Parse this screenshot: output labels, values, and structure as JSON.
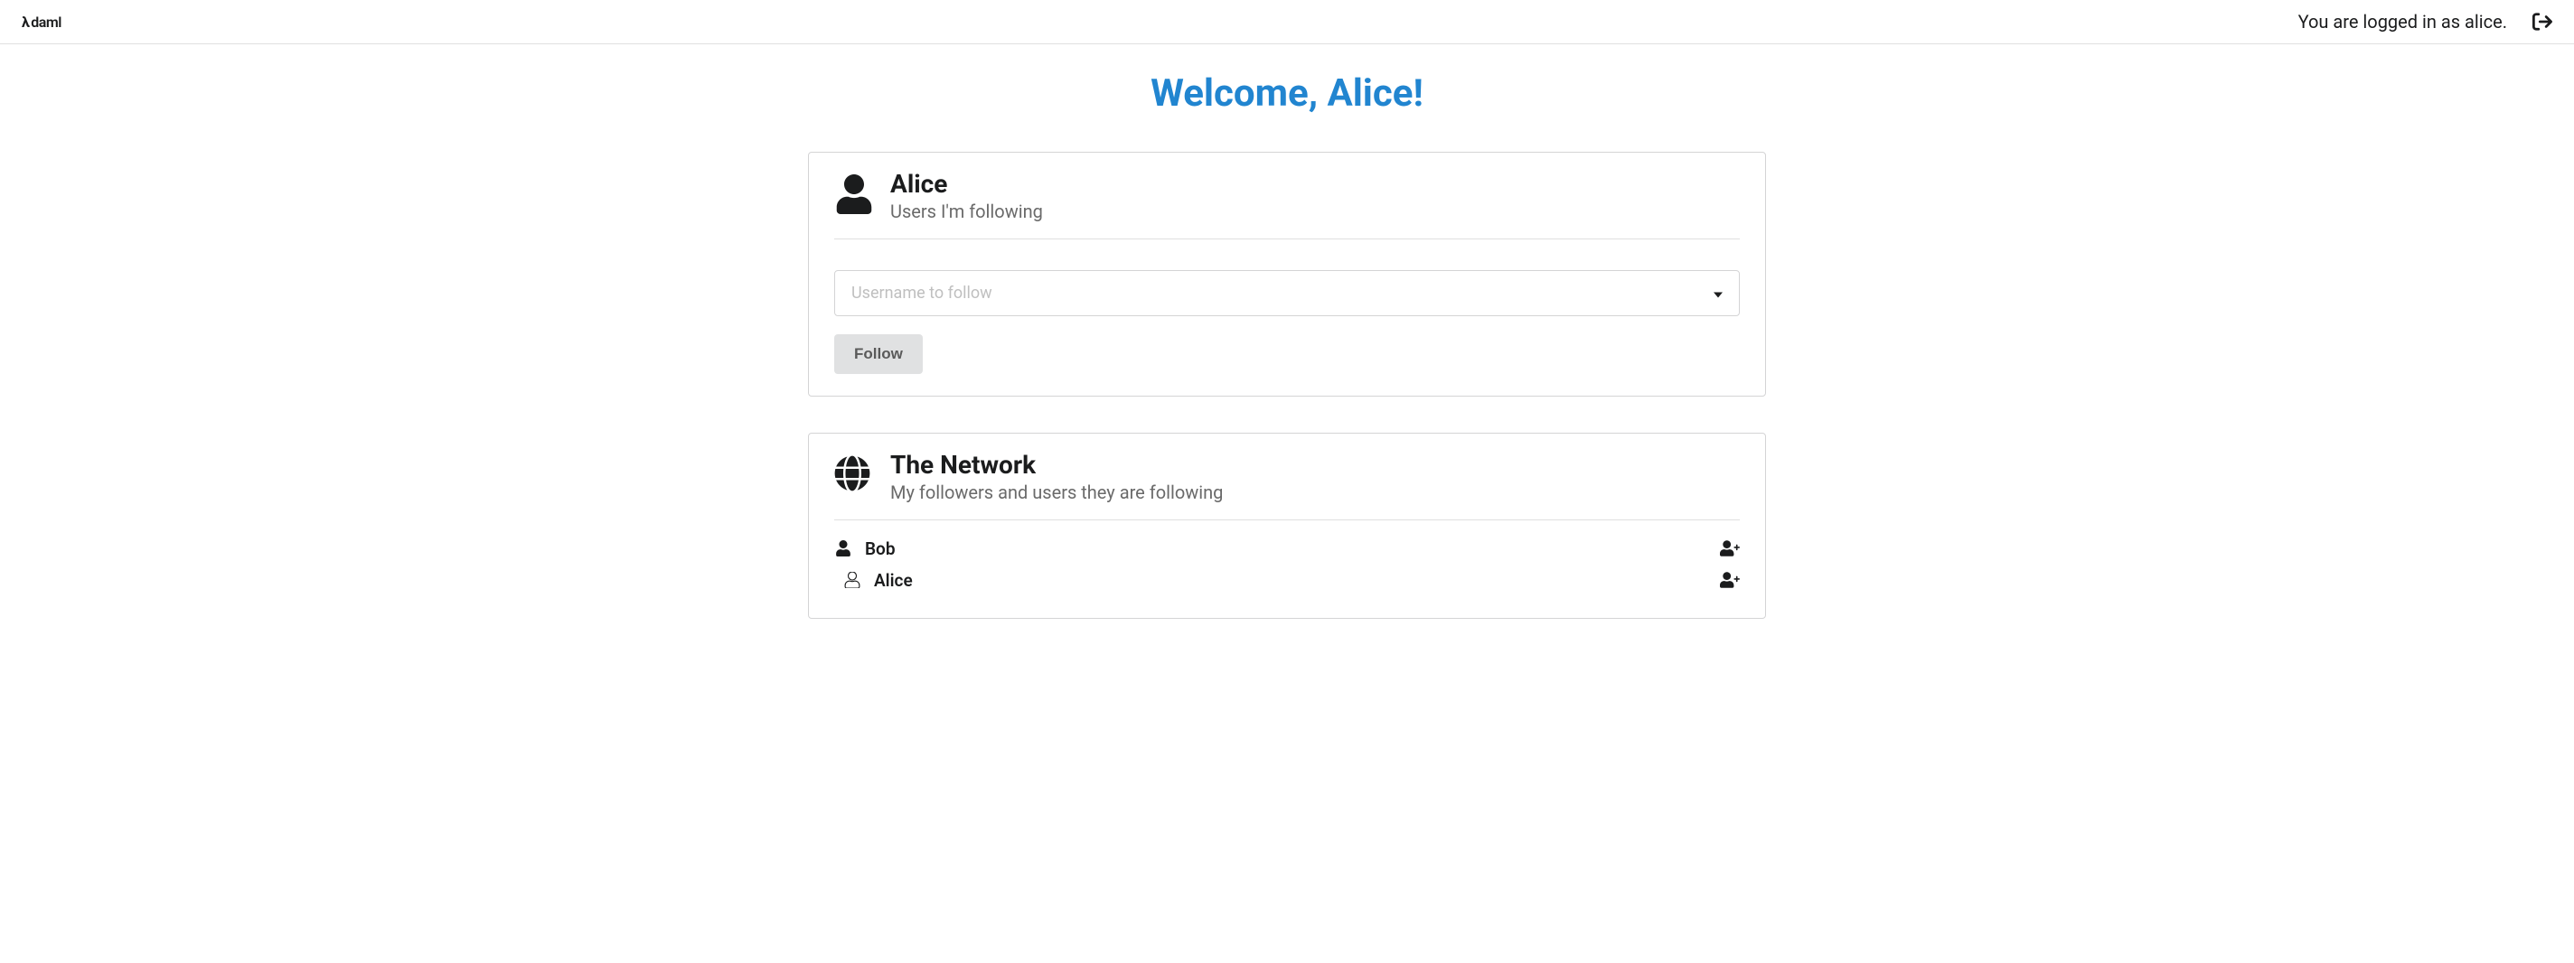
{
  "brand": {
    "name": "daml"
  },
  "header": {
    "login_status": "You are logged in as alice."
  },
  "welcome": {
    "text": "Welcome, Alice!"
  },
  "profile_card": {
    "title": "Alice",
    "subtitle": "Users I'm following",
    "follow_input_placeholder": "Username to follow",
    "follow_button_label": "Follow"
  },
  "network_card": {
    "title": "The Network",
    "subtitle": "My followers and users they are following",
    "rows": [
      {
        "name": "Bob",
        "indented": false,
        "icon": "user-solid"
      },
      {
        "name": "Alice",
        "indented": true,
        "icon": "user-outline"
      }
    ]
  }
}
